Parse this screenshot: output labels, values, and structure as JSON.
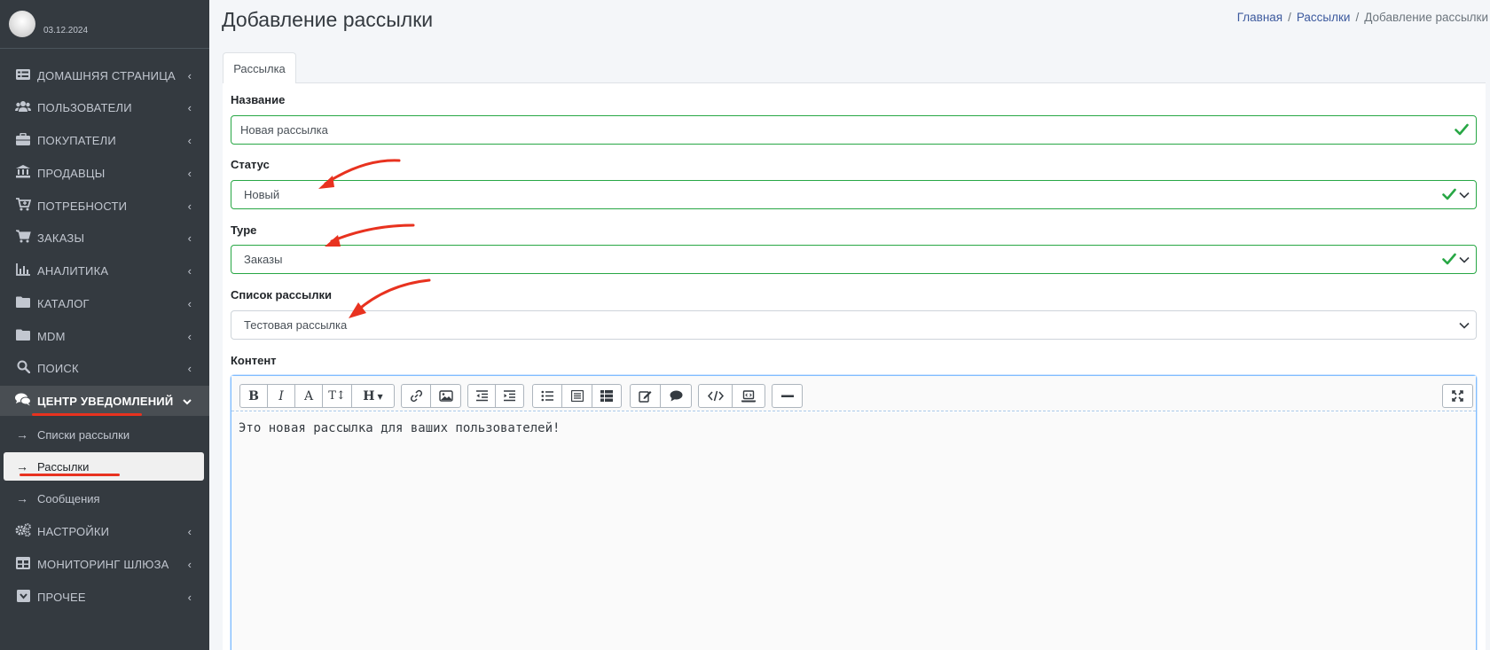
{
  "sidebar": {
    "user_date": "03.12.2024",
    "items": [
      {
        "label": "ДОМАШНЯЯ СТРАНИЦА",
        "icon": "home-list-icon"
      },
      {
        "label": "ПОЛЬЗОВАТЕЛИ",
        "icon": "users-icon"
      },
      {
        "label": "ПОКУПАТЕЛИ",
        "icon": "briefcase-icon"
      },
      {
        "label": "ПРОДАВЦЫ",
        "icon": "bank-icon"
      },
      {
        "label": "ПОТРЕБНОСТИ",
        "icon": "cart-plus-icon"
      },
      {
        "label": "ЗАКАЗЫ",
        "icon": "cart-icon"
      },
      {
        "label": "АНАЛИТИКА",
        "icon": "chart-icon"
      },
      {
        "label": "КАТАЛОГ",
        "icon": "folder-icon"
      },
      {
        "label": "MDM",
        "icon": "folder-icon"
      },
      {
        "label": "ПОИСК",
        "icon": "search-icon"
      },
      {
        "label": "ЦЕНТР УВЕДОМЛЕНИЙ",
        "icon": "comments-icon"
      },
      {
        "label": "НАСТРОЙКИ",
        "icon": "gears-icon"
      },
      {
        "label": "МОНИТОРИНГ ШЛЮЗА",
        "icon": "table-icon"
      },
      {
        "label": "ПРОЧЕЕ",
        "icon": "inbox-icon"
      }
    ],
    "subitems": [
      {
        "label": "Списки рассылки"
      },
      {
        "label": "Рассылки"
      },
      {
        "label": "Сообщения"
      }
    ]
  },
  "header": {
    "title": "Добавление рассылки",
    "breadcrumb": {
      "home": "Главная",
      "section": "Рассылки",
      "current": "Добавление рассылки"
    }
  },
  "tab": {
    "label": "Рассылка"
  },
  "form": {
    "name": {
      "label": "Название",
      "value": "Новая рассылка"
    },
    "status": {
      "label": "Статус",
      "value": "Новый"
    },
    "type": {
      "label": "Type",
      "value": "Заказы"
    },
    "list": {
      "label": "Список рассылки",
      "value": "Тестовая рассылка"
    },
    "content": {
      "label": "Контент",
      "value": "Это новая рассылка для ваших пользователей!"
    }
  },
  "toolbar": {
    "bold": "B",
    "italic": "I",
    "font": "A",
    "size": "T↕",
    "heading": "H"
  },
  "colors": {
    "sidebar_bg": "#343a40",
    "valid": "#28a745",
    "annotation": "#e8321f",
    "link": "#3d5a9e"
  }
}
